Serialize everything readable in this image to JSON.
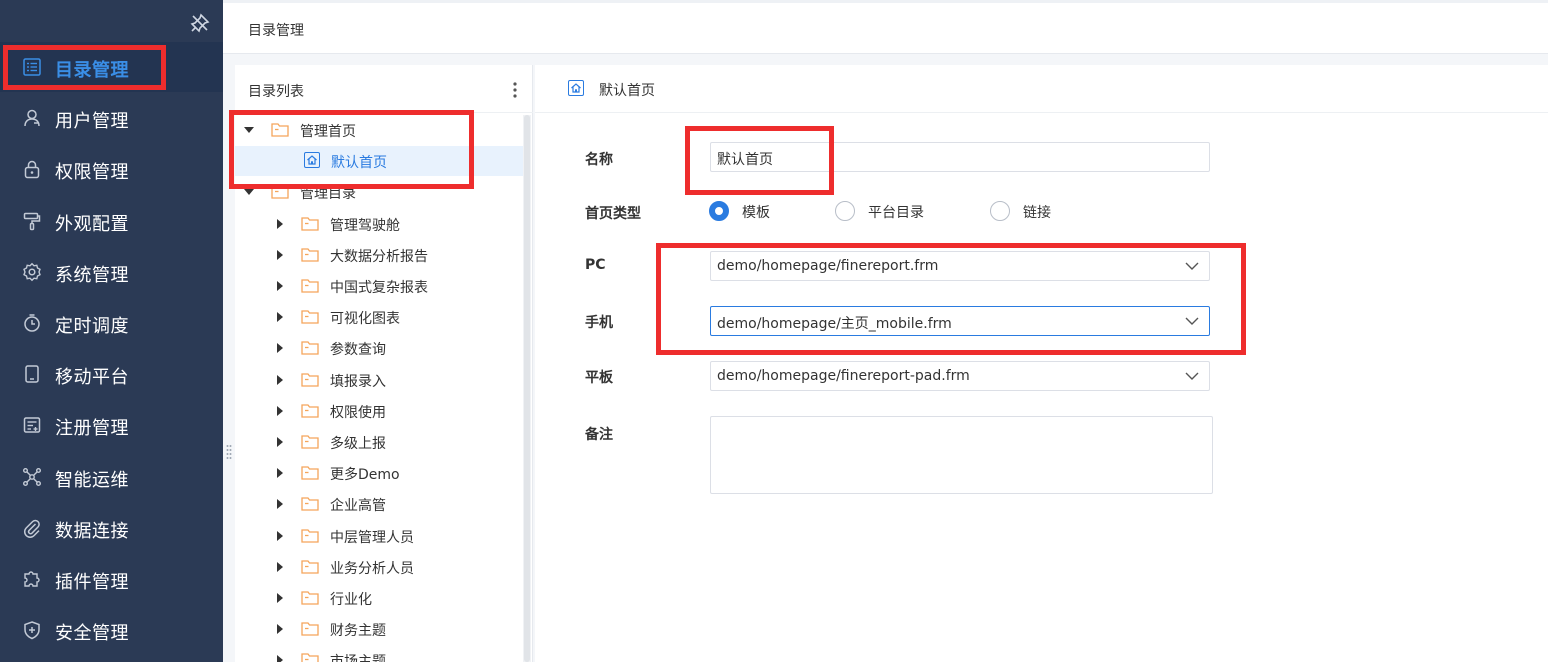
{
  "sidebar": {
    "items": [
      {
        "label": "目录管理",
        "icon": "catalog-list-icon",
        "active": true
      },
      {
        "label": "用户管理",
        "icon": "user-icon"
      },
      {
        "label": "权限管理",
        "icon": "lock-icon"
      },
      {
        "label": "外观配置",
        "icon": "paint-roller-icon"
      },
      {
        "label": "系统管理",
        "icon": "gear-icon"
      },
      {
        "label": "定时调度",
        "icon": "timer-icon"
      },
      {
        "label": "移动平台",
        "icon": "tablet-icon"
      },
      {
        "label": "注册管理",
        "icon": "register-icon"
      },
      {
        "label": "智能运维",
        "icon": "network-nodes-icon"
      },
      {
        "label": "数据连接",
        "icon": "paperclip-icon"
      },
      {
        "label": "插件管理",
        "icon": "puzzle-icon"
      },
      {
        "label": "安全管理",
        "icon": "shield-icon"
      }
    ]
  },
  "header": {
    "title": "目录管理"
  },
  "tree": {
    "title": "目录列表",
    "nodes": [
      {
        "label": "管理首页",
        "level": 0,
        "expanded": true
      },
      {
        "label": "默认首页",
        "level": 1,
        "selected": true,
        "icon": "home-page-icon"
      },
      {
        "label": "管理目录",
        "level": 0,
        "expanded": true
      },
      {
        "label": "管理驾驶舱",
        "level": 1
      },
      {
        "label": "大数据分析报告",
        "level": 1
      },
      {
        "label": "中国式复杂报表",
        "level": 1
      },
      {
        "label": "可视化图表",
        "level": 1
      },
      {
        "label": "参数查询",
        "level": 1
      },
      {
        "label": "填报录入",
        "level": 1
      },
      {
        "label": "权限使用",
        "level": 1
      },
      {
        "label": "多级上报",
        "level": 1
      },
      {
        "label": "更多Demo",
        "level": 1
      },
      {
        "label": "企业高管",
        "level": 1
      },
      {
        "label": "中层管理人员",
        "level": 1
      },
      {
        "label": "业务分析人员",
        "level": 1
      },
      {
        "label": "行业化",
        "level": 1
      },
      {
        "label": "财务主题",
        "level": 1
      },
      {
        "label": "市场主题",
        "level": 1
      }
    ]
  },
  "detail": {
    "title": "默认首页",
    "name_label": "名称",
    "name_value": "默认首页",
    "type_label": "首页类型",
    "type_options": [
      "模板",
      "平台目录",
      "链接"
    ],
    "type_selected": "模板",
    "pc_label": "PC",
    "pc_value": "demo/homepage/finereport.frm",
    "mobile_label": "手机",
    "mobile_value": "demo/homepage/主页_mobile.frm",
    "pad_label": "平板",
    "pad_value": "demo/homepage/finereport-pad.frm",
    "remark_label": "备注",
    "remark_value": ""
  },
  "colors": {
    "sidebar_bg": "#2b3a55",
    "accent": "#2a7be0",
    "folder": "#f5a55a",
    "highlight": "#ee2d2d"
  }
}
